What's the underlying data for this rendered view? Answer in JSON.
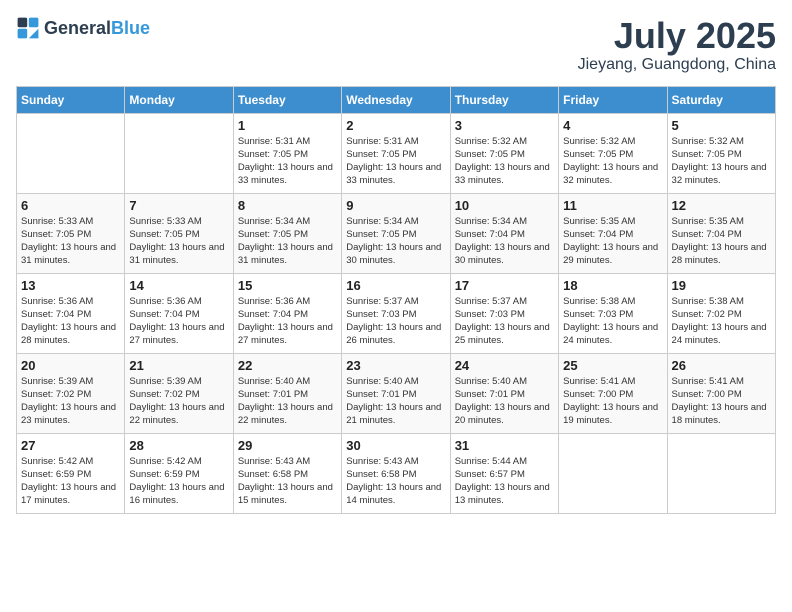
{
  "header": {
    "logo_general": "General",
    "logo_blue": "Blue",
    "month": "July 2025",
    "location": "Jieyang, Guangdong, China"
  },
  "days_of_week": [
    "Sunday",
    "Monday",
    "Tuesday",
    "Wednesday",
    "Thursday",
    "Friday",
    "Saturday"
  ],
  "weeks": [
    [
      {
        "day": "",
        "info": ""
      },
      {
        "day": "",
        "info": ""
      },
      {
        "day": "1",
        "info": "Sunrise: 5:31 AM\nSunset: 7:05 PM\nDaylight: 13 hours and 33 minutes."
      },
      {
        "day": "2",
        "info": "Sunrise: 5:31 AM\nSunset: 7:05 PM\nDaylight: 13 hours and 33 minutes."
      },
      {
        "day": "3",
        "info": "Sunrise: 5:32 AM\nSunset: 7:05 PM\nDaylight: 13 hours and 33 minutes."
      },
      {
        "day": "4",
        "info": "Sunrise: 5:32 AM\nSunset: 7:05 PM\nDaylight: 13 hours and 32 minutes."
      },
      {
        "day": "5",
        "info": "Sunrise: 5:32 AM\nSunset: 7:05 PM\nDaylight: 13 hours and 32 minutes."
      }
    ],
    [
      {
        "day": "6",
        "info": "Sunrise: 5:33 AM\nSunset: 7:05 PM\nDaylight: 13 hours and 31 minutes."
      },
      {
        "day": "7",
        "info": "Sunrise: 5:33 AM\nSunset: 7:05 PM\nDaylight: 13 hours and 31 minutes."
      },
      {
        "day": "8",
        "info": "Sunrise: 5:34 AM\nSunset: 7:05 PM\nDaylight: 13 hours and 31 minutes."
      },
      {
        "day": "9",
        "info": "Sunrise: 5:34 AM\nSunset: 7:05 PM\nDaylight: 13 hours and 30 minutes."
      },
      {
        "day": "10",
        "info": "Sunrise: 5:34 AM\nSunset: 7:04 PM\nDaylight: 13 hours and 30 minutes."
      },
      {
        "day": "11",
        "info": "Sunrise: 5:35 AM\nSunset: 7:04 PM\nDaylight: 13 hours and 29 minutes."
      },
      {
        "day": "12",
        "info": "Sunrise: 5:35 AM\nSunset: 7:04 PM\nDaylight: 13 hours and 28 minutes."
      }
    ],
    [
      {
        "day": "13",
        "info": "Sunrise: 5:36 AM\nSunset: 7:04 PM\nDaylight: 13 hours and 28 minutes."
      },
      {
        "day": "14",
        "info": "Sunrise: 5:36 AM\nSunset: 7:04 PM\nDaylight: 13 hours and 27 minutes."
      },
      {
        "day": "15",
        "info": "Sunrise: 5:36 AM\nSunset: 7:04 PM\nDaylight: 13 hours and 27 minutes."
      },
      {
        "day": "16",
        "info": "Sunrise: 5:37 AM\nSunset: 7:03 PM\nDaylight: 13 hours and 26 minutes."
      },
      {
        "day": "17",
        "info": "Sunrise: 5:37 AM\nSunset: 7:03 PM\nDaylight: 13 hours and 25 minutes."
      },
      {
        "day": "18",
        "info": "Sunrise: 5:38 AM\nSunset: 7:03 PM\nDaylight: 13 hours and 24 minutes."
      },
      {
        "day": "19",
        "info": "Sunrise: 5:38 AM\nSunset: 7:02 PM\nDaylight: 13 hours and 24 minutes."
      }
    ],
    [
      {
        "day": "20",
        "info": "Sunrise: 5:39 AM\nSunset: 7:02 PM\nDaylight: 13 hours and 23 minutes."
      },
      {
        "day": "21",
        "info": "Sunrise: 5:39 AM\nSunset: 7:02 PM\nDaylight: 13 hours and 22 minutes."
      },
      {
        "day": "22",
        "info": "Sunrise: 5:40 AM\nSunset: 7:01 PM\nDaylight: 13 hours and 22 minutes."
      },
      {
        "day": "23",
        "info": "Sunrise: 5:40 AM\nSunset: 7:01 PM\nDaylight: 13 hours and 21 minutes."
      },
      {
        "day": "24",
        "info": "Sunrise: 5:40 AM\nSunset: 7:01 PM\nDaylight: 13 hours and 20 minutes."
      },
      {
        "day": "25",
        "info": "Sunrise: 5:41 AM\nSunset: 7:00 PM\nDaylight: 13 hours and 19 minutes."
      },
      {
        "day": "26",
        "info": "Sunrise: 5:41 AM\nSunset: 7:00 PM\nDaylight: 13 hours and 18 minutes."
      }
    ],
    [
      {
        "day": "27",
        "info": "Sunrise: 5:42 AM\nSunset: 6:59 PM\nDaylight: 13 hours and 17 minutes."
      },
      {
        "day": "28",
        "info": "Sunrise: 5:42 AM\nSunset: 6:59 PM\nDaylight: 13 hours and 16 minutes."
      },
      {
        "day": "29",
        "info": "Sunrise: 5:43 AM\nSunset: 6:58 PM\nDaylight: 13 hours and 15 minutes."
      },
      {
        "day": "30",
        "info": "Sunrise: 5:43 AM\nSunset: 6:58 PM\nDaylight: 13 hours and 14 minutes."
      },
      {
        "day": "31",
        "info": "Sunrise: 5:44 AM\nSunset: 6:57 PM\nDaylight: 13 hours and 13 minutes."
      },
      {
        "day": "",
        "info": ""
      },
      {
        "day": "",
        "info": ""
      }
    ]
  ]
}
